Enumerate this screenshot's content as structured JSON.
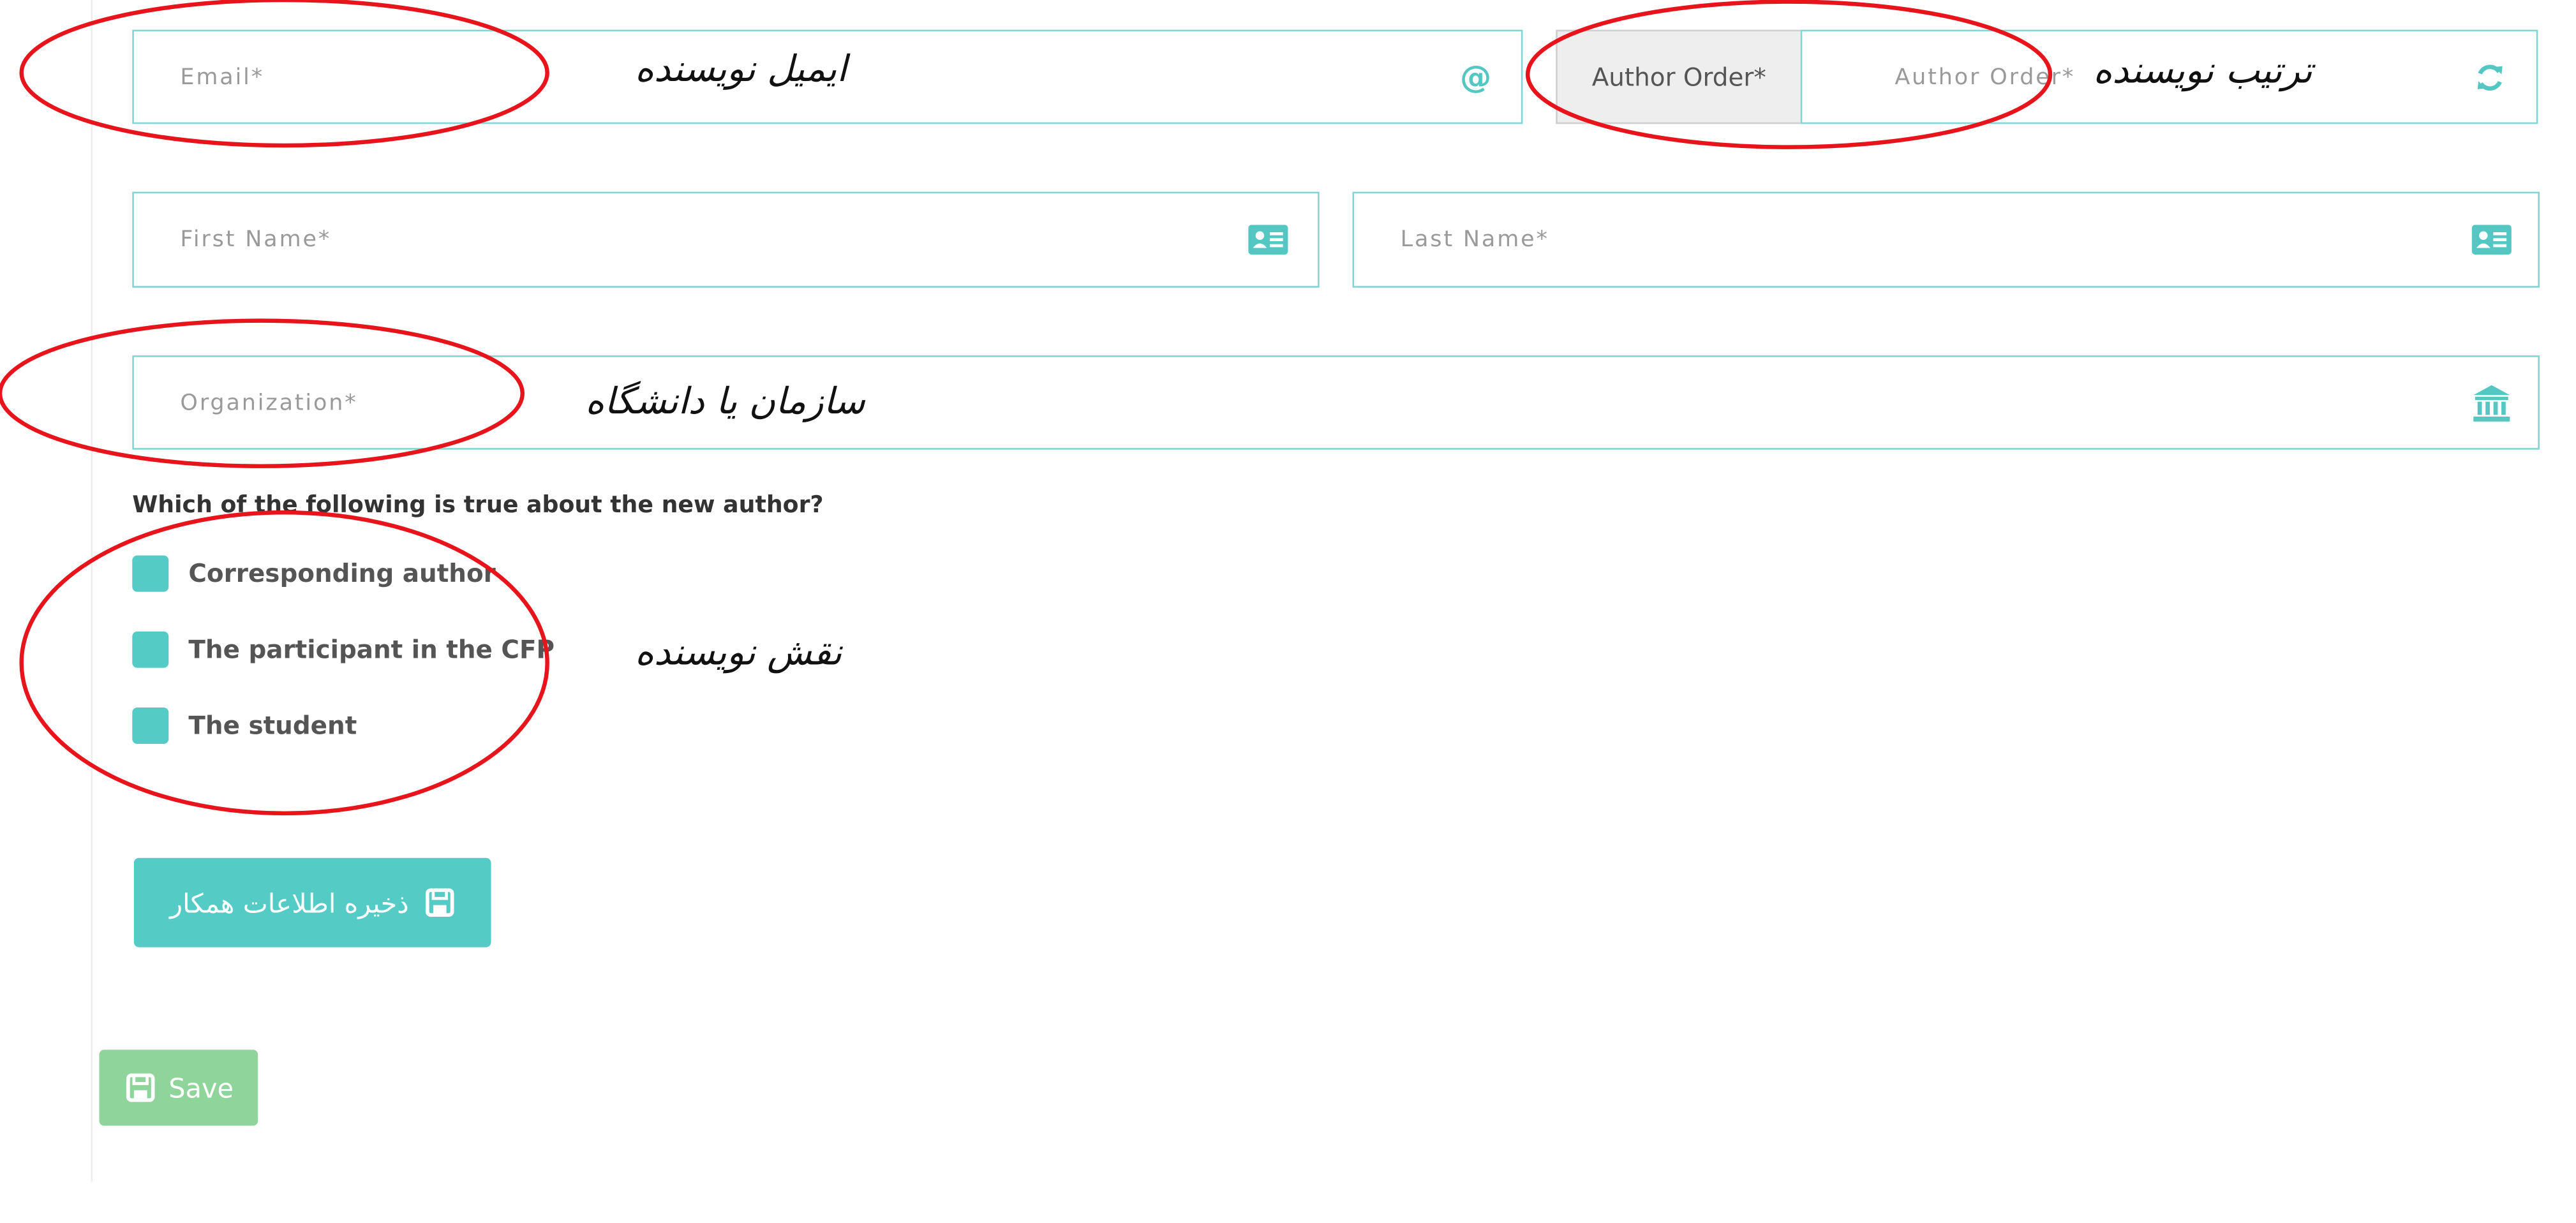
{
  "form": {
    "email": {
      "placeholder": "Email*",
      "icon": "at-icon"
    },
    "author_order": {
      "addon_label": "Author Order*",
      "placeholder": "Author Order*",
      "icon": "refresh-icon"
    },
    "first_name": {
      "placeholder": "First Name*",
      "icon": "id-card-icon"
    },
    "last_name": {
      "placeholder": "Last Name*",
      "icon": "id-card-icon"
    },
    "organization": {
      "placeholder": "Organization*",
      "icon": "institution-icon"
    },
    "question": "Which of the following is true about the new author?",
    "options": [
      {
        "label": "Corresponding author"
      },
      {
        "label": "The participant in the CFP"
      },
      {
        "label": "The student"
      }
    ],
    "save_coauthor_label": "ذخیره اطلاعات همکار",
    "save_label": "Save"
  },
  "annotations": {
    "email": "ایمیل نویسنده",
    "author_order": "ترتیب نویسنده",
    "organization": "سازمان یا دانشگاه",
    "role": "نقش نویسنده"
  },
  "colors": {
    "accent": "#55cbc6",
    "field_border": "#7fd6d2",
    "save_button": "#8fd49a",
    "annotation_ellipse": "#e8141b"
  }
}
